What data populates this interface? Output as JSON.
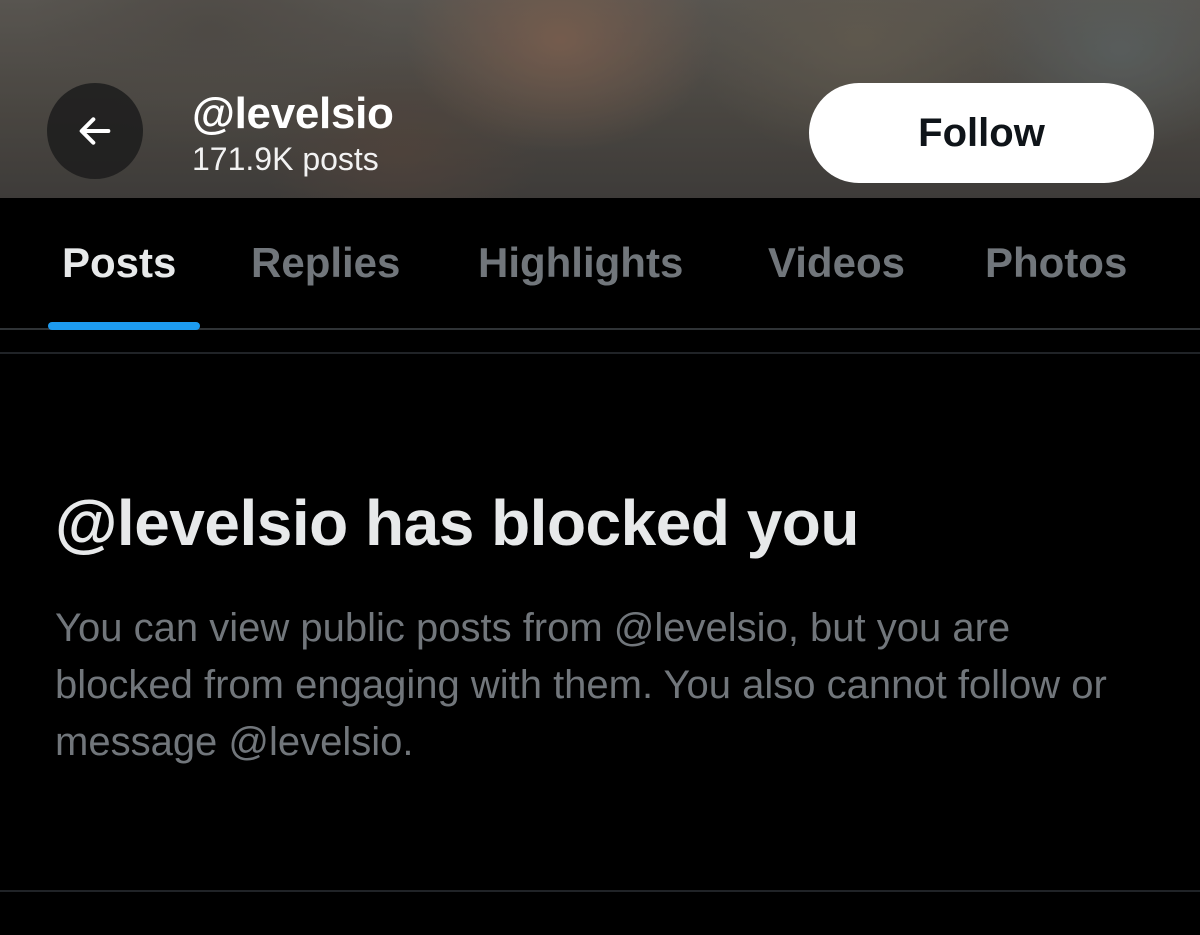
{
  "header": {
    "handle": "@levelsio",
    "post_count": "171.9K posts",
    "follow_label": "Follow"
  },
  "tabs": [
    {
      "label": "Posts",
      "active": true
    },
    {
      "label": "Replies",
      "active": false
    },
    {
      "label": "Highlights",
      "active": false
    },
    {
      "label": "Videos",
      "active": false
    },
    {
      "label": "Photos",
      "active": false
    }
  ],
  "blocked": {
    "title": "@levelsio has blocked you",
    "message": "You can view public posts from @levelsio, but you are blocked from engaging with them. You also cannot follow or message @levelsio."
  },
  "icons": {
    "back": "arrow-left-icon"
  },
  "colors": {
    "background": "#000000",
    "accent": "#1d9bf0",
    "primary_text": "#e7e9ea",
    "secondary_text": "#71767b",
    "follow_button_bg": "#ffffff"
  }
}
